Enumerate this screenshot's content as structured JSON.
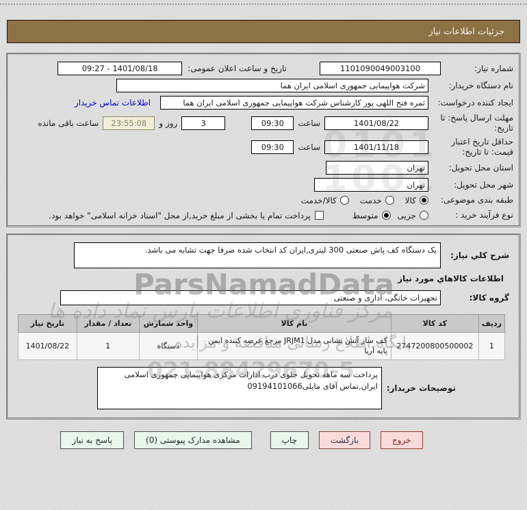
{
  "header": {
    "title": "جزئیات اطلاعات نیاز"
  },
  "form": {
    "need_number": {
      "label": "شماره نیاز:",
      "value": "1101090049003100"
    },
    "announce_datetime": {
      "label": "تاریخ و ساعت اعلان عمومی:",
      "value": "1401/08/18 - 09:27"
    },
    "buyer_org": {
      "label": "نام دستگاه خریدار:",
      "value": "شرکت هواپیمایی جمهوری اسلامی ایران هما"
    },
    "request_creator": {
      "label": "ایجاد کننده درخواست:",
      "value": "ثمره فتح اللهی پور کارشناس شرکت هواپیمایی جمهوری اسلامی ایران هما",
      "contact_link": "اطلاعات تماس خریدار"
    },
    "reply_deadline": {
      "label": "مهلت ارسال پاسخ: تا تاریخ:",
      "date": "1401/08/22",
      "time_label": "ساعت",
      "time": "09:30",
      "days": "3",
      "days_label": "روز و",
      "countdown": "23:55:08",
      "countdown_label": "ساعت باقی مانده"
    },
    "price_validity": {
      "label": "حداقل تاریخ اعتبار قیمت: تا تاریخ:",
      "date": "1401/11/18",
      "time_label": "ساعت",
      "time": "09:30"
    },
    "province": {
      "label": "استان محل تحویل:",
      "value": "تهران"
    },
    "city": {
      "label": "شهر محل تحویل:",
      "value": "تهران"
    },
    "category": {
      "label": "طبقه بندی موضوعی:",
      "options": [
        {
          "label": "کالا",
          "selected": true
        },
        {
          "label": "خدمت",
          "selected": false
        },
        {
          "label": "کالا/خدمت",
          "selected": false
        }
      ]
    },
    "process_type": {
      "label": "نوع فرآیند خرید :",
      "options": [
        {
          "label": "جزیی",
          "selected": false
        },
        {
          "label": "متوسط",
          "selected": true
        }
      ],
      "checkbox_label": "پرداخت تمام یا بخشی از مبلغ خرید,از محل \"اسناد خزانه اسلامی\" خواهد بود.",
      "checkbox_checked": false
    }
  },
  "need_section": {
    "description": {
      "label": "شرح کلي نياز:",
      "value": "یک دستگاه کف پاش صنعتی 300 لیتری,ایران کد انتخاب شده صرفا جهت تشابه می باشد."
    },
    "items_header": "اطلاعات کالاهاي مورد نياز",
    "goods_group": {
      "label": "گروه کالا:",
      "value": "تجهیزات خانگی، اداری و صنعتی"
    },
    "table": {
      "headers": [
        "ردیف",
        "کد کالا",
        "نام کالا",
        "واحد شمارش",
        "تعداد / مقدار",
        "تاریخ نیاز"
      ],
      "rows": [
        [
          "1",
          "2747200800500002",
          "کف ساز آتش نشانی مدل JRJM1 مرجع عرضه کننده ایمن پایه آریا",
          "دستگاه",
          "1",
          "1401/08/22"
        ]
      ]
    },
    "buyer_notes": {
      "label": "توضیحات خریدار:",
      "value": "پرداخت سه ماهه تحویل جلوی درب ادارات مرکزی هواپیمایی جمهوری اسلامی ایران,تماس آقای مایلی09194101066"
    }
  },
  "buttons": [
    {
      "label": "پاسخ به نیاز"
    },
    {
      "label": "مشاهده مدارک پیوستی (0)"
    },
    {
      "label": "چاپ"
    },
    {
      "label": "بازگشت"
    },
    {
      "label": "خروج"
    }
  ],
  "watermarks": {
    "digits": "0101\n1001",
    "brand": "ParsNamadData",
    "calligraphy": "مرکز فناوری اطلاعات پارس نماد داده ها",
    "line2": "پایگاه اطلاع رسانی مناقصه و مزایده",
    "phone": "021-88429670-5"
  },
  "colors": {
    "title_bar": "#8d7245",
    "page_bg": "#dcdcdc",
    "countdown_bg": "#f0eed8",
    "button_green": "#e9f6ec",
    "button_pink": "#fbdada",
    "link": "#0000cc",
    "table_header_bg": "#c9c9c9"
  }
}
